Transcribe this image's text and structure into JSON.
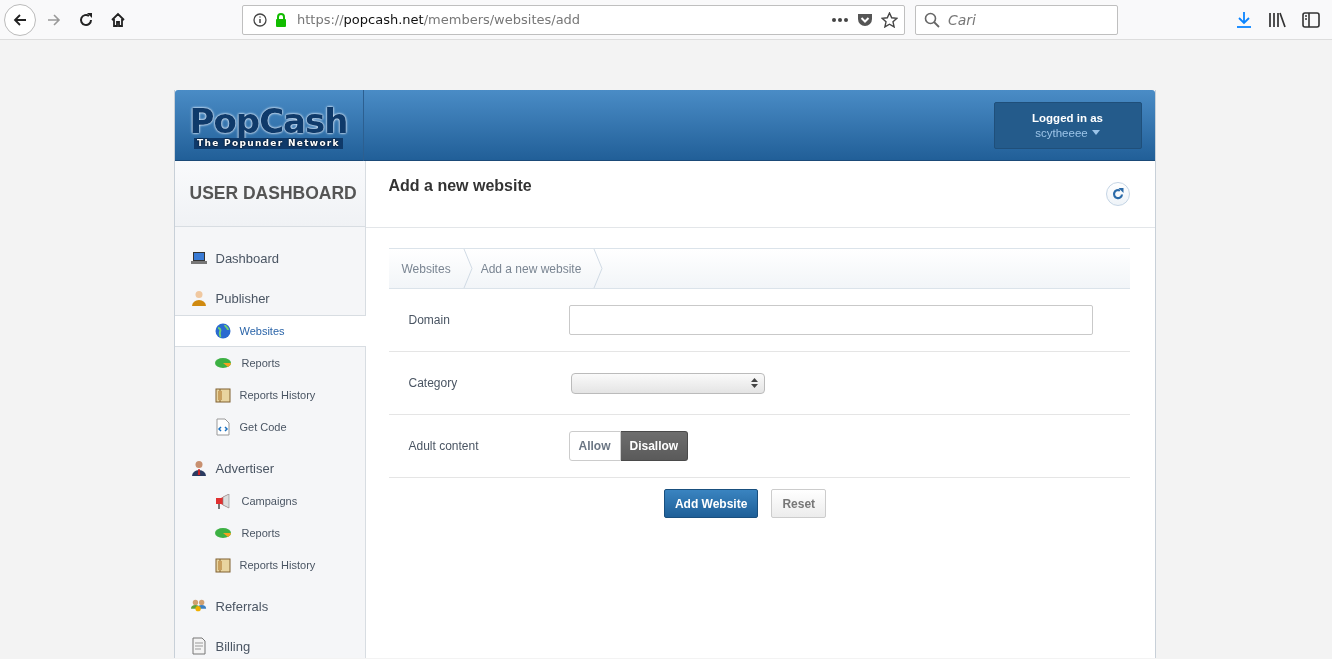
{
  "browser": {
    "url_scheme": "https://",
    "url_host": "popcash.net",
    "url_path": "/members/websites/add",
    "search": {
      "placeholder": "Cari"
    }
  },
  "header": {
    "logo": {
      "name": "PopCash",
      "tagline": "The Popunder Network"
    },
    "user": {
      "label": "Logged in as",
      "name": "scytheeee"
    }
  },
  "sidebar": {
    "title": "USER DASHBOARD",
    "items": [
      {
        "label": "Dashboard",
        "kind": "laptop",
        "selected": false
      },
      {
        "label": "Publisher",
        "kind": "person",
        "selected": false,
        "children": [
          {
            "label": "Websites",
            "kind": "globe",
            "selected": true
          },
          {
            "label": "Reports",
            "kind": "pie",
            "selected": false
          },
          {
            "label": "Reports History",
            "kind": "folder",
            "selected": false
          },
          {
            "label": "Get Code",
            "kind": "code",
            "selected": false
          }
        ]
      },
      {
        "label": "Advertiser",
        "kind": "suit",
        "selected": false,
        "children": [
          {
            "label": "Campaigns",
            "kind": "megaphone",
            "selected": false
          },
          {
            "label": "Reports",
            "kind": "pie",
            "selected": false
          },
          {
            "label": "Reports History",
            "kind": "folder",
            "selected": false
          }
        ]
      },
      {
        "label": "Referrals",
        "kind": "people",
        "selected": false
      },
      {
        "label": "Billing",
        "kind": "doc",
        "selected": false
      }
    ]
  },
  "main": {
    "title": "Add a new website",
    "breadcrumb": [
      "Websites",
      "Add a new website"
    ],
    "form": {
      "rows": [
        {
          "kind": "text",
          "label": "Domain"
        },
        {
          "kind": "select",
          "label": "Category"
        },
        {
          "kind": "toggle",
          "label": "Adult content",
          "options": [
            {
              "label": "Allow",
              "selected": false
            },
            {
              "label": "Disallow",
              "selected": true
            }
          ]
        }
      ]
    },
    "buttons": [
      {
        "label": "Add Website",
        "kind": "primary"
      },
      {
        "label": "Reset",
        "kind": "default"
      }
    ]
  }
}
